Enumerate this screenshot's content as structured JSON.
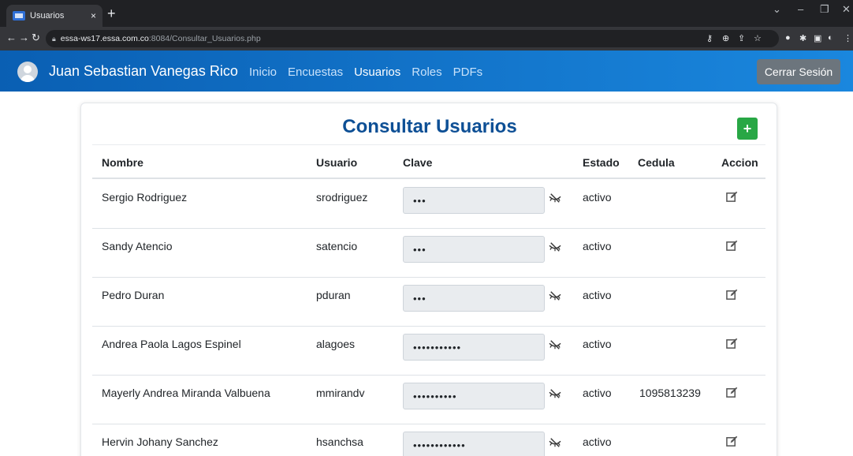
{
  "browser": {
    "tab_title": "Usuarios",
    "tab_close": "×",
    "new_tab": "+",
    "url_host": "essa-ws17.essa.com.co",
    "url_path": ":8084/Consultar_Usuarios.php"
  },
  "navbar": {
    "user_name": "Juan Sebastian Vanegas Rico",
    "links": [
      {
        "label": "Inicio",
        "active": false
      },
      {
        "label": "Encuestas",
        "active": false
      },
      {
        "label": "Usuarios",
        "active": true
      },
      {
        "label": "Roles",
        "active": false
      },
      {
        "label": "PDFs",
        "active": false
      }
    ],
    "logout_label": "Cerrar Sesión",
    "accent": "#0a5fb3"
  },
  "page": {
    "title": "Consultar Usuarios",
    "add_button": "+",
    "add_button_color": "#28a745"
  },
  "table": {
    "headers": {
      "nombre": "Nombre",
      "usuario": "Usuario",
      "clave": "Clave",
      "estado": "Estado",
      "cedula": "Cedula",
      "accion": "Accion"
    },
    "rows": [
      {
        "nombre": "Sergio Rodriguez",
        "usuario": "srodriguez",
        "clave_mask": "•••",
        "estado": "activo",
        "cedula": ""
      },
      {
        "nombre": "Sandy Atencio",
        "usuario": "satencio",
        "clave_mask": "•••",
        "estado": "activo",
        "cedula": ""
      },
      {
        "nombre": "Pedro Duran",
        "usuario": "pduran",
        "clave_mask": "•••",
        "estado": "activo",
        "cedula": ""
      },
      {
        "nombre": "Andrea Paola Lagos Espinel",
        "usuario": "alagoes",
        "clave_mask": "•••••••••••",
        "estado": "activo",
        "cedula": ""
      },
      {
        "nombre": "Mayerly Andrea Miranda Valbuena",
        "usuario": "mmirandv",
        "clave_mask": "••••••••••",
        "estado": "activo",
        "cedula": "1095813239"
      },
      {
        "nombre": "Hervin Johany Sanchez",
        "usuario": "hsanchsa",
        "clave_mask": "••••••••••••",
        "estado": "activo",
        "cedula": ""
      }
    ]
  }
}
